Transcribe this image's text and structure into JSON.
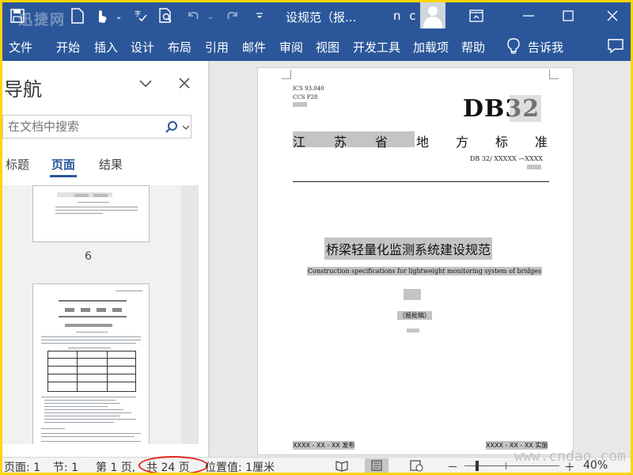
{
  "titlebar": {
    "watermark": "迅捷网",
    "doc_title": "设规范（报...",
    "user": "n c",
    "icons": [
      "save-icon",
      "new-doc-icon",
      "touch-mode-icon",
      "dropdown-icon",
      "spelling-icon",
      "print-preview-icon",
      "undo-icon",
      "redo-icon",
      "customize-qat-icon"
    ]
  },
  "ribbon": {
    "tabs": [
      "文件",
      "开始",
      "插入",
      "设计",
      "布局",
      "引用",
      "邮件",
      "审阅",
      "视图",
      "开发工具",
      "加载项",
      "帮助",
      "告诉我"
    ]
  },
  "nav": {
    "title": "导航",
    "search_placeholder": "在文档中搜索",
    "tabs": [
      "标题",
      "页面",
      "结果"
    ],
    "active_tab": "页面",
    "thumb_page_label": "6"
  },
  "document": {
    "ics": "ICS  93.040",
    "ccs": "CCS  P28",
    "db": "DB32",
    "province_chars": [
      "江",
      "苏",
      "省",
      "地",
      "方",
      "标",
      "准"
    ],
    "std_no": "DB 32/  XXXXX  —XXXX",
    "title_cn": "桥梁轻量化监测系统建设规范",
    "title_en": "Construction specifications for lightweight monitoring system of bridges",
    "draft": "（报批稿）",
    "publish": "XXXX - XX - XX 发布",
    "implement": "XXXX - XX - XX 实施"
  },
  "status": {
    "page": "页面: 1",
    "section": "节: 1",
    "page_of": "第 1 页,",
    "total": "共 24 页",
    "position": "位置值: 1厘米",
    "zoom": "40%",
    "zoom_minus": "－",
    "zoom_plus": "＋"
  },
  "watermark_br": "www.cndao.com",
  "colors": {
    "ribbon_blue": "#2b579a",
    "border_yellow": "#ffd400",
    "highlight_ellipse": "#e1231b"
  }
}
